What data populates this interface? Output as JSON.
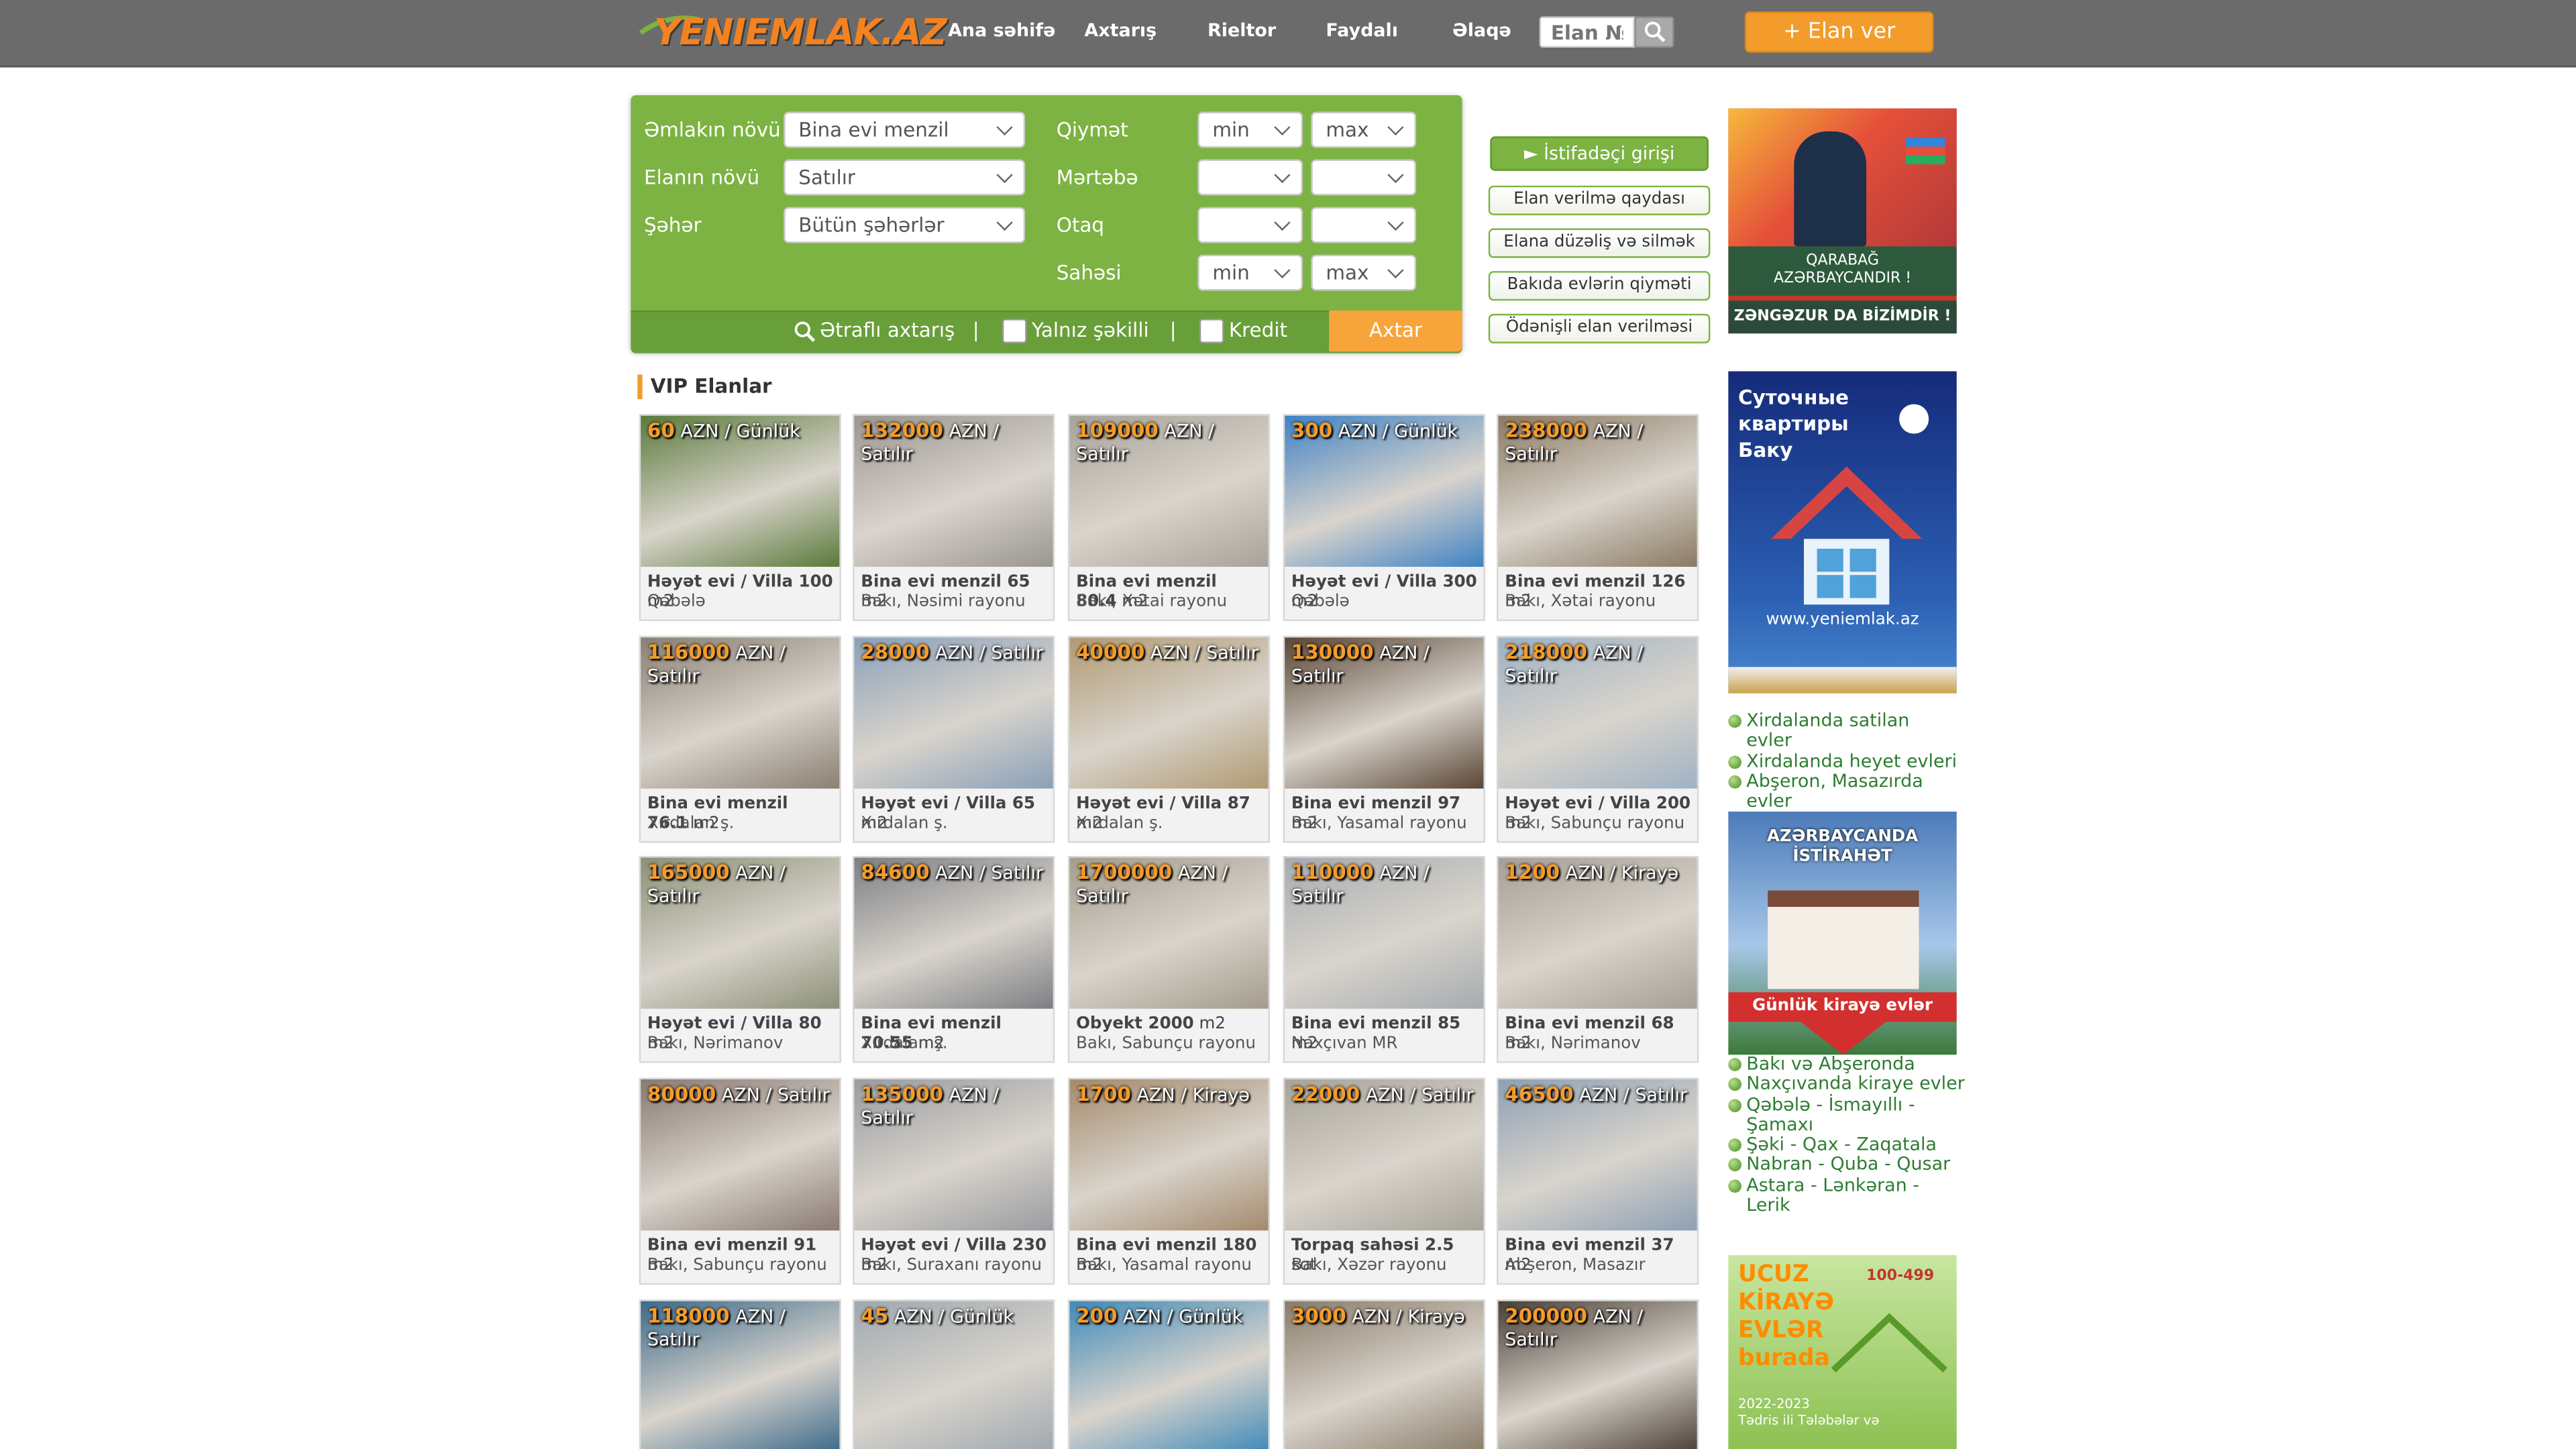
{
  "header": {
    "logo_text": "YENIEMLAK.AZ",
    "nav": [
      "Ana səhifə",
      "Axtarış",
      "Rieltor",
      "Faydalı",
      "Əlaqə"
    ],
    "search_placeholder": "Elan №",
    "post_button": "+ Elan ver"
  },
  "search": {
    "property_type_label": "Əmlakın növü",
    "property_type_value": "Bina evi menzil",
    "listing_type_label": "Elanın növü",
    "listing_type_value": "Satılır",
    "city_label": "Şəhər",
    "city_value": "Bütün şəhərlər",
    "price_label": "Qiymət",
    "floor_label": "Mərtəbə",
    "rooms_label": "Otaq",
    "area_label": "Sahəsi",
    "min": "min",
    "max": "max",
    "advanced": "Ətraflı axtarış",
    "separator": "|",
    "photos_only": "Yalnız şəkilli",
    "credit": "Kredit",
    "submit": "Axtar"
  },
  "side_buttons": {
    "login": "► İstifadəçi girişi",
    "items": [
      "Elan verilmə qaydası",
      "Elana düzəliş və silmək",
      "Bakıda evlərin qiyməti",
      "Ödənişli elan verilməsi"
    ]
  },
  "vip_title": "VIP Elanlar",
  "listings": [
    {
      "price": "60",
      "unit": "AZN / Günlük",
      "title": "Həyət evi / Villa",
      "size": "100",
      "sunit": "m2",
      "location": "Qəbələ",
      "color": "#5a7a3a"
    },
    {
      "price": "132000",
      "unit": "AZN / Satılır",
      "title": "Bina evi menzil",
      "size": "65",
      "sunit": "m2",
      "location": "Bakı, Nəsimi rayonu",
      "color": "#9a9690"
    },
    {
      "price": "109000",
      "unit": "AZN / Satılır",
      "title": "Bina evi menzil",
      "size": "80.4",
      "sunit": "m2",
      "location": "Bakı, Xətai rayonu",
      "color": "#a7a39a"
    },
    {
      "price": "300",
      "unit": "AZN / Günlük",
      "title": "Həyət evi / Villa",
      "size": "300",
      "sunit": "m2",
      "location": "Qəbələ",
      "color": "#3f82c4"
    },
    {
      "price": "238000",
      "unit": "AZN / Satılır",
      "title": "Bina evi menzil",
      "size": "126",
      "sunit": "m2",
      "location": "Bakı, Xətai rayonu",
      "color": "#8b7a63"
    },
    {
      "price": "116000",
      "unit": "AZN / Satılır",
      "title": "Bina evi menzil",
      "size": "76.1",
      "sunit": "m2",
      "location": "Xırdalan ş.",
      "color": "#8a7f72"
    },
    {
      "price": "28000",
      "unit": "AZN / Satılır",
      "title": "Həyət evi / Villa",
      "size": "65",
      "sunit": "m2",
      "location": "Xırdalan ş.",
      "color": "#8aa0b8"
    },
    {
      "price": "40000",
      "unit": "AZN / Satılır",
      "title": "Həyət evi / Villa",
      "size": "87",
      "sunit": "m2",
      "location": "Xırdalan ş.",
      "color": "#b09a72"
    },
    {
      "price": "130000",
      "unit": "AZN / Satılır",
      "title": "Bina evi menzil",
      "size": "97",
      "sunit": "m2",
      "location": "Bakı, Yasamal rayonu",
      "color": "#5a4636"
    },
    {
      "price": "218000",
      "unit": "AZN / Satılır",
      "title": "Həyət evi / Villa",
      "size": "200",
      "sunit": "m2",
      "location": "Bakı, Sabunçu rayonu",
      "color": "#9fb2c4"
    },
    {
      "price": "165000",
      "unit": "AZN / Satılır",
      "title": "Həyət evi / Villa",
      "size": "80",
      "sunit": "m2",
      "location": "Bakı, Nərimanov",
      "color": "#8c9078"
    },
    {
      "price": "84600",
      "unit": "AZN / Satılır",
      "title": "Bina evi menzil",
      "size": "70.55",
      "sunit": "m2",
      "location": "Xırdalan ş.",
      "color": "#7d7f84"
    },
    {
      "price": "1700000",
      "unit": "AZN / Satılır",
      "title": "Obyekt",
      "size": "2000",
      "sunit": "m2",
      "location": "Bakı, Sabunçu rayonu",
      "color": "#a49c8c"
    },
    {
      "price": "110000",
      "unit": "AZN / Satılır",
      "title": "Bina evi menzil",
      "size": "85",
      "sunit": "m2",
      "location": "Naxçıvan MR",
      "color": "#a6abb0"
    },
    {
      "price": "1200",
      "unit": "AZN / Kirayə",
      "title": "Bina evi menzil",
      "size": "68",
      "sunit": "m2",
      "location": "Bakı, Nərimanov",
      "color": "#a59f94"
    },
    {
      "price": "80000",
      "unit": "AZN / Satılır",
      "title": "Bina evi menzil",
      "size": "91",
      "sunit": "m2",
      "location": "Bakı, Sabunçu rayonu",
      "color": "#8a7a72"
    },
    {
      "price": "135000",
      "unit": "AZN / Satılır",
      "title": "Həyət evi / Villa",
      "size": "230",
      "sunit": "m2",
      "location": "Bakı, Suraxanı rayonu",
      "color": "#9a9ca0"
    },
    {
      "price": "1700",
      "unit": "AZN / Kirayə",
      "title": "Bina evi menzil",
      "size": "180",
      "sunit": "m2",
      "location": "Bakı, Yasamal rayonu",
      "color": "#a48a6c"
    },
    {
      "price": "22000",
      "unit": "AZN / Satılır",
      "title": "Torpaq sahəsi",
      "size": "2.5",
      "sunit": "sot",
      "location": "Bakı, Xəzər rayonu",
      "color": "#a8a49a"
    },
    {
      "price": "46500",
      "unit": "AZN / Satılır",
      "title": "Bina evi menzil",
      "size": "37",
      "sunit": "m2",
      "location": "Abşeron, Masazır",
      "color": "#8ea0b4"
    },
    {
      "price": "118000",
      "unit": "AZN / Satılır",
      "title": "",
      "size": "",
      "sunit": "",
      "location": "",
      "color": "#3c6a8a"
    },
    {
      "price": "45",
      "unit": "AZN / Günlük",
      "title": "",
      "size": "",
      "sunit": "",
      "location": "",
      "color": "#9fa8b0"
    },
    {
      "price": "200",
      "unit": "AZN / Günlük",
      "title": "",
      "size": "",
      "sunit": "",
      "location": "",
      "color": "#3f8ab8"
    },
    {
      "price": "3000",
      "unit": "AZN / Kirayə",
      "title": "",
      "size": "",
      "sunit": "",
      "location": "",
      "color": "#8a7c6a"
    },
    {
      "price": "200000",
      "unit": "AZN / Satılır",
      "title": "",
      "size": "",
      "sunit": "",
      "location": "",
      "color": "#4a3f36"
    }
  ],
  "ads": {
    "karabakh_line1": "QARABAĞ",
    "karabakh_line2": "AZƏRBAYCANDIR !",
    "zangezur": "ZƏNGƏZUR DA BİZİMDİR !",
    "daily_text": "Суточные квартиры Баку",
    "daily_url": "www.yeniemlak.az",
    "rest_title": "AZƏRBAYCANDA İSTİRAHƏT",
    "rest_sub": "Günlük kirayə evlər",
    "cheap_title": "UCUZ KİRAYƏ EVLƏR burada",
    "cheap_price": "100-499",
    "cheap_year": "2022-2023",
    "cheap_sub": "Tədris ili Tələbələr və"
  },
  "side_links_1": [
    "Xirdalanda satilan evler",
    "Xirdalanda heyet evleri",
    "Abşeron, Masazırda evler"
  ],
  "side_links_2": [
    "Bakı və Abşeronda",
    "Naxçıvanda kiraye evler",
    "Qəbələ - İsmayıllı - Şamaxı",
    "Şəki - Qax - Zaqatala",
    "Nabran - Quba - Qusar",
    "Astara - Lənkəran - Lerik"
  ]
}
